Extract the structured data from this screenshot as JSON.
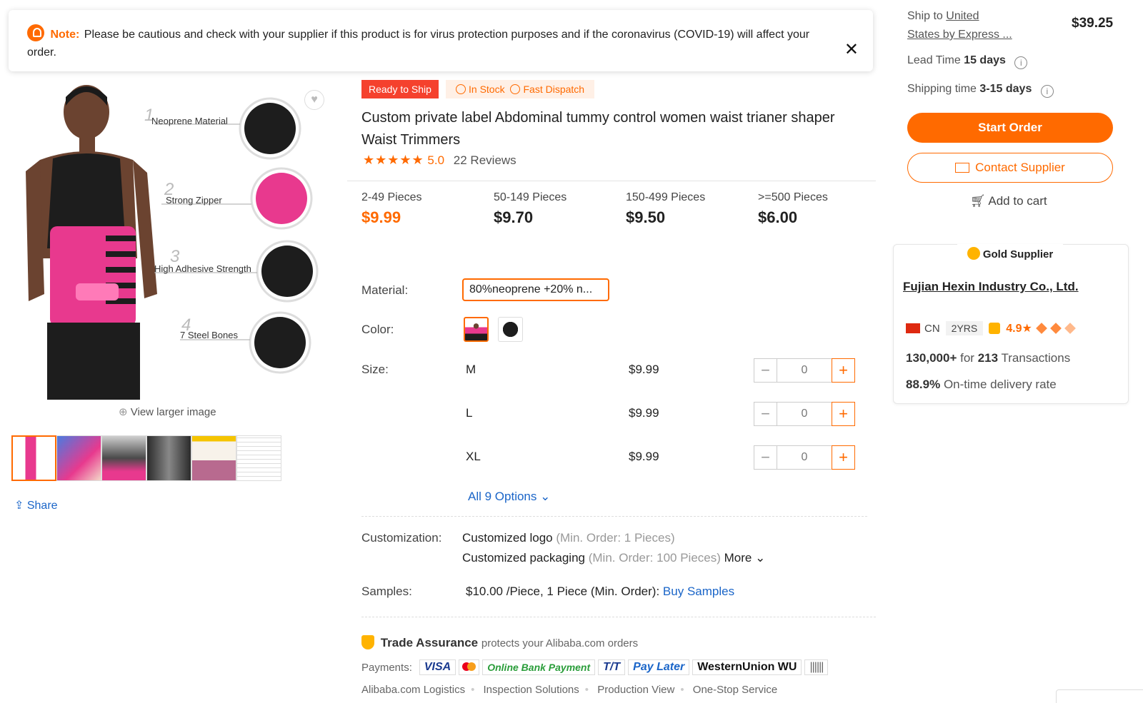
{
  "note": {
    "label": "Note:",
    "text": "Please be cautious and check with your supplier if this product is for virus protection purposes and if the coronavirus (COVID-19) will affect your order.",
    "close": "✕"
  },
  "gallery": {
    "callouts": [
      "Neoprene Material",
      "Strong Zipper",
      "High Adhesive Strength",
      "7 Steel Bones"
    ],
    "callout_numbers": [
      "1",
      "2",
      "3",
      "4"
    ],
    "view_larger": "View larger image",
    "share": "Share",
    "thumb_count": 6
  },
  "tags": {
    "ready": "Ready to Ship",
    "in_stock": "In Stock",
    "fast_dispatch": "Fast Dispatch"
  },
  "product": {
    "title": "Custom private label Abdominal tummy control women waist trianer shaper Waist Trimmers",
    "stars": "★★★★★",
    "rating": "5.0",
    "reviews": "22 Reviews"
  },
  "tiers": [
    {
      "qty": "2-49 Pieces",
      "price": "$9.99"
    },
    {
      "qty": "50-149 Pieces",
      "price": "$9.70"
    },
    {
      "qty": "150-499 Pieces",
      "price": "$9.50"
    },
    {
      "qty": ">=500 Pieces",
      "price": "$6.00"
    }
  ],
  "options": {
    "material_label": "Material:",
    "material_value": "80%neoprene +20% n...",
    "color_label": "Color:",
    "size_label": "Size:",
    "sizes": [
      {
        "size": "M",
        "price": "$9.99",
        "qty": "0"
      },
      {
        "size": "L",
        "price": "$9.99",
        "qty": "0"
      },
      {
        "size": "XL",
        "price": "$9.99",
        "qty": "0"
      }
    ],
    "minus": "−",
    "plus": "+",
    "all_options": "All 9 Options"
  },
  "customization": {
    "label": "Customization:",
    "logo": "Customized logo",
    "logo_min": "(Min. Order: 1 Pieces)",
    "packaging": "Customized packaging",
    "packaging_min": "(Min. Order: 100 Pieces)",
    "more": "More"
  },
  "samples": {
    "label": "Samples:",
    "value": "$10.00 /Piece, 1 Piece (Min. Order):",
    "link": "Buy Samples"
  },
  "trade": {
    "title": "Trade Assurance",
    "sub": "protects your Alibaba.com orders",
    "payments_label": "Payments:",
    "methods": [
      "VISA",
      "Online Bank Payment",
      "T/T",
      "Pay Later",
      "WesternUnion WU"
    ],
    "services": [
      "Alibaba.com Logistics",
      "Inspection Solutions",
      "Production View",
      "One-Stop Service"
    ]
  },
  "shipping": {
    "ship_to": "Ship to",
    "destination_line1": "United",
    "destination_line2": "States by Express ...",
    "price": "$39.25",
    "lead_label": "Lead Time",
    "lead_value": "15 days",
    "shiptime_label": "Shipping time",
    "shiptime_value": "3-15 days"
  },
  "actions": {
    "start_order": "Start Order",
    "contact_supplier": "Contact Supplier",
    "add_to_cart": "Add to cart"
  },
  "supplier": {
    "badge": "Gold Supplier",
    "name": "Fujian Hexin Industry Co., Ltd.",
    "country": "CN",
    "years": "2YRS",
    "score": "4.9★",
    "transactions_amount": "130,000+",
    "transactions_mid": "for",
    "transactions_count": "213",
    "transactions_label": "Transactions",
    "ontime": "88.9%",
    "ontime_label": "On-time delivery rate"
  },
  "colors": {
    "accent": "#ff6a00",
    "link": "#1a65c8",
    "ready_tag": "#f5412d",
    "product_pink": "#e8398e"
  }
}
